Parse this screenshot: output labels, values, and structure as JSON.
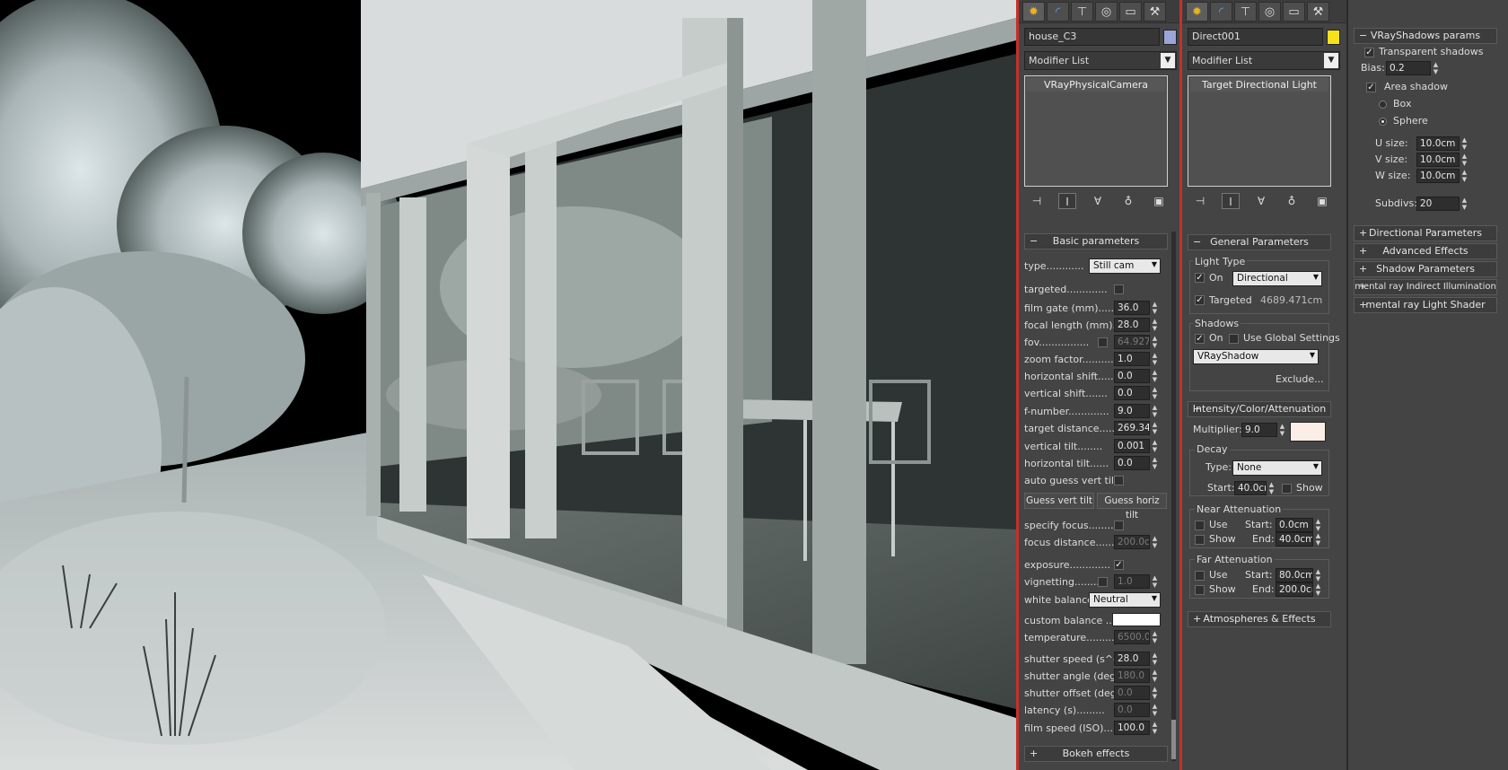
{
  "camera_panel": {
    "object_name": "house_C3",
    "swatch_color": "#9aa6d8",
    "modifier_list": "Modifier List",
    "stack_item": "VRayPhysicalCamera",
    "basic_params_title": "Basic parameters",
    "type_label": "type............",
    "type_value": "Still cam",
    "targeted_label": "targeted.............",
    "film_gate_label": "film gate (mm).......",
    "film_gate": "36.0",
    "focal_length_label": "focal length (mm)....",
    "focal_length": "28.0",
    "fov_label": "fov................",
    "fov": "64.927",
    "zoom_label": "zoom factor..........",
    "zoom": "1.0",
    "hshift_label": "horizontal shift.....",
    "hshift": "0.0",
    "vshift_label": "vertical shift.......",
    "vshift": "0.0",
    "fnumber_label": "f-number.............",
    "fnumber": "9.0",
    "target_dist_label": "target distance......",
    "target_dist": "269.34",
    "vtilt_label": "vertical tilt........",
    "vtilt": "0.001",
    "htilt_label": "horizontal tilt......",
    "htilt": "0.0",
    "auto_guess_label": "auto guess vert tilt.",
    "guess_vert_btn": "Guess vert tilt",
    "guess_horiz_btn": "Guess horiz tilt",
    "specify_focus_label": "specify focus........",
    "focus_dist_label": "focus distance.......",
    "focus_dist": "200.0cr",
    "exposure_label": "exposure.............",
    "vignetting_label": "vignetting........",
    "vignetting": "1.0",
    "white_balance_label": "white balance",
    "white_balance": "Neutral",
    "custom_balance_label": "custom balance .....",
    "temperature_label": "temperature.........",
    "temperature": "6500.0",
    "shutter_speed_label": "shutter speed (s^-1",
    "shutter_speed": "28.0",
    "shutter_angle_label": "shutter angle (deg).",
    "shutter_angle": "180.0",
    "shutter_offset_label": "shutter offset (deg)",
    "shutter_offset": "0.0",
    "latency_label": "latency (s).........",
    "latency": "0.0",
    "film_speed_label": "film speed (ISO).....",
    "film_speed": "100.0",
    "bokeh_title": "Bokeh effects"
  },
  "light_panel": {
    "object_name": "Direct001",
    "swatch_color": "#f5e21a",
    "modifier_list": "Modifier List",
    "stack_item": "Target Directional Light",
    "general_title": "General Parameters",
    "light_type_group": "Light Type",
    "on_label": "On",
    "light_type_value": "Directional",
    "targeted_label": "Targeted",
    "targeted_value": "4689.471cm",
    "shadows_group": "Shadows",
    "shadows_on_label": "On",
    "use_global_label": "Use Global Settings",
    "shadow_type": "VRayShadow",
    "exclude_btn": "Exclude...",
    "intensity_title": "Intensity/Color/Attenuation",
    "multiplier_label": "Multiplier:",
    "multiplier": "9.0",
    "decay_group": "Decay",
    "decay_type_label": "Type:",
    "decay_type": "None",
    "decay_start_label": "Start:",
    "decay_start": "40.0cn",
    "decay_show_label": "Show",
    "near_group": "Near Attenuation",
    "near_use": "Use",
    "near_show": "Show",
    "near_start_label": "Start:",
    "near_start": "0.0cm",
    "near_end_label": "End:",
    "near_end": "40.0cm",
    "far_group": "Far Attenuation",
    "far_use": "Use",
    "far_show": "Show",
    "far_start_label": "Start:",
    "far_start": "80.0cm",
    "far_end_label": "End:",
    "far_end": "200.0cm",
    "atmos_title": "Atmospheres & Effects"
  },
  "shadow_panel": {
    "title": "VRayShadows params",
    "transparent_label": "Transparent shadows",
    "bias_label": "Bias:",
    "bias": "0.2",
    "area_label": "Area shadow",
    "box_label": "Box",
    "sphere_label": "Sphere",
    "u_label": "U size:",
    "u_size": "10.0cm",
    "v_label": "V size:",
    "v_size": "10.0cm",
    "w_label": "W size:",
    "w_size": "10.0cm",
    "subdivs_label": "Subdivs:",
    "subdivs": "20",
    "rollouts": [
      "Directional Parameters",
      "Advanced Effects",
      "Shadow Parameters",
      "mental ray Indirect Illumination",
      "mental ray Light Shader"
    ]
  },
  "colors": {
    "panel_bg": "#444444",
    "active_border": "#c4312a"
  }
}
